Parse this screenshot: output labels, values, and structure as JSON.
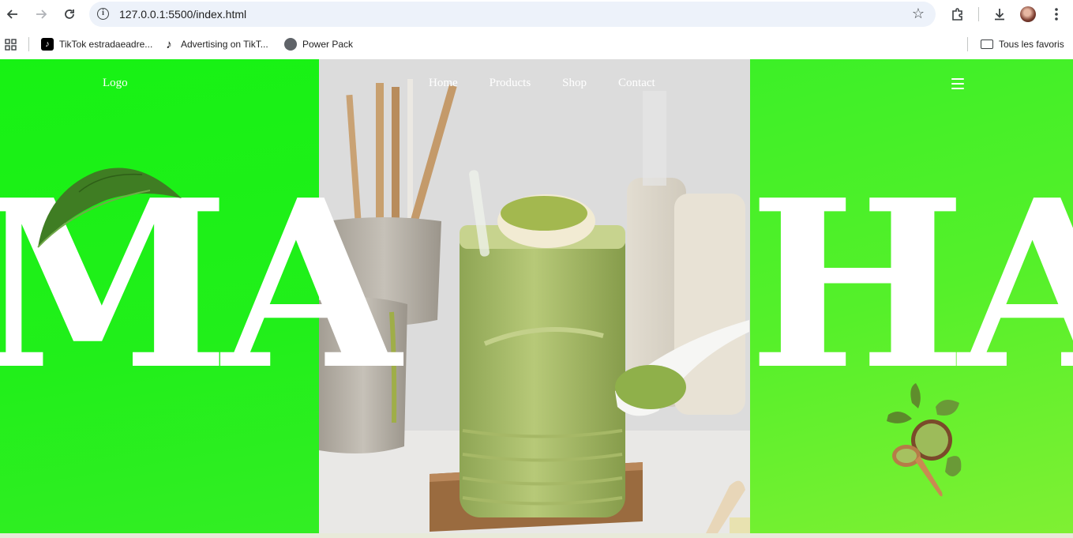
{
  "browser": {
    "url": "127.0.0.1:5500/index.html",
    "icons": {
      "back": "arrow-left-icon",
      "forward": "arrow-right-icon",
      "reload": "reload-icon",
      "site_info": "info-icon",
      "bookmark": "star-icon",
      "extensions": "puzzle-icon",
      "downloads": "download-icon",
      "profile": "avatar",
      "menu": "vertical-dots-icon",
      "apps": "apps-grid-icon"
    }
  },
  "bookmarks": {
    "items": [
      {
        "label": "TikTok estradaeadre...",
        "icon": "tiktok-icon"
      },
      {
        "label": "Advertising on TikT...",
        "icon": "tiktok-icon"
      },
      {
        "label": "Power Pack",
        "icon": "globe-icon"
      }
    ],
    "all_bookmarks": "Tous les favoris"
  },
  "site": {
    "logo": "Logo",
    "nav": [
      "Home",
      "Products",
      "Shop",
      "Contact"
    ],
    "hero_left": "MA",
    "hero_right": "HA",
    "colors": {
      "accent_green": "#21ef1a",
      "light_green": "#7ff033",
      "hero_text": "#ffffff",
      "matcha": "#9dbb5a"
    }
  }
}
